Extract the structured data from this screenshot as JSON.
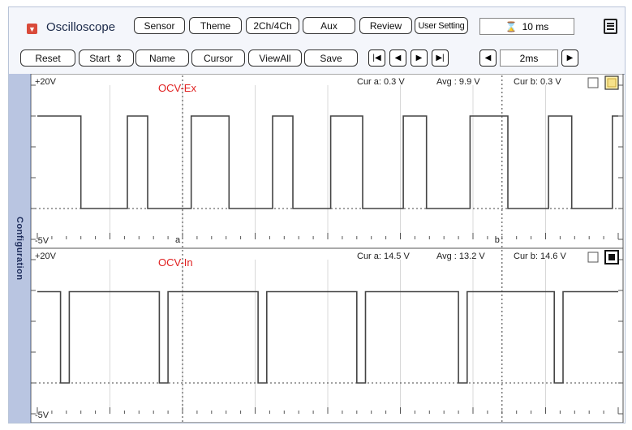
{
  "app": {
    "title": "Oscilloscope",
    "title_icon": "dropdown-arrow-icon"
  },
  "toolbar_top": {
    "sensor": "Sensor",
    "theme": "Theme",
    "channels": "2Ch/4Ch",
    "aux": "Aux",
    "review": "Review",
    "user_setting": "User Setting",
    "time": "10 ms",
    "time_icon": "hourglass-icon",
    "menu_icon": "menu-icon"
  },
  "toolbar_bottom": {
    "reset": "Reset",
    "start": "Start",
    "start_arrows": "⇕",
    "name": "Name",
    "cursor": "Cursor",
    "viewall": "ViewAll",
    "save": "Save",
    "nav_first": "|◀",
    "nav_prev": "◀",
    "nav_next": "▶",
    "nav_last": "▶|",
    "timebase_left": "◀",
    "timebase": "2ms",
    "timebase_right": "▶"
  },
  "sidebar": {
    "label": "Configuration"
  },
  "channels": [
    {
      "name": "OCV-Ex",
      "ymax_label": "+20V",
      "ymin_label": "-5V",
      "cur_a": "Cur a: 0.3 V",
      "avg": "Avg : 9.9 V",
      "cur_b": "Cur b: 0.3 V",
      "cursor_a_label": "a",
      "cursor_b_label": "b",
      "label_color": "#e02020"
    },
    {
      "name": "OCV-In",
      "ymax_label": "+20V",
      "ymin_label": "-5V",
      "cur_a": "Cur a: 14.5 V",
      "avg": "Avg : 13.2 V",
      "cur_b": "Cur b: 14.6 V",
      "label_color": "#e02020"
    }
  ],
  "chart_data": [
    {
      "type": "line",
      "series": [
        {
          "name": "OCV-Ex",
          "x": [
            0,
            1.5,
            1.5,
            3.1,
            3.1,
            3.8,
            3.8,
            5.3,
            5.3,
            6.6,
            6.6,
            8.1,
            8.1,
            8.8,
            8.8,
            10.1,
            10.1,
            11.2,
            11.2,
            12.6,
            12.6,
            13.4,
            13.4,
            14.9,
            14.9,
            16.2,
            16.2,
            17.6,
            17.6,
            18.4,
            18.4,
            19.8,
            19.8,
            20
          ],
          "y": [
            15,
            15,
            0,
            0,
            15,
            15,
            0,
            0,
            15,
            15,
            0,
            0,
            15,
            15,
            0,
            0,
            15,
            15,
            0,
            0,
            15,
            15,
            0,
            0,
            15,
            15,
            0,
            0,
            15,
            15,
            0,
            0,
            15,
            15
          ]
        }
      ],
      "ylim": [
        -5,
        20
      ],
      "xlim": [
        0,
        20
      ],
      "grid": true,
      "cursors": [
        5,
        16
      ]
    },
    {
      "type": "line",
      "series": [
        {
          "name": "OCV-In",
          "x": [
            0,
            0.8,
            0.8,
            1.1,
            1.1,
            4.2,
            4.2,
            4.5,
            4.5,
            7.6,
            7.6,
            7.9,
            7.9,
            11.0,
            11.0,
            11.3,
            11.3,
            14.5,
            14.5,
            14.8,
            14.8,
            17.8,
            17.8,
            18.1,
            18.1,
            20
          ],
          "y": [
            14.8,
            14.8,
            0,
            0,
            14.8,
            14.8,
            0,
            0,
            14.8,
            14.8,
            0,
            0,
            14.8,
            14.8,
            0,
            0,
            14.8,
            14.8,
            0,
            0,
            14.8,
            14.8,
            0,
            0,
            14.8,
            14.8
          ]
        }
      ],
      "ylim": [
        -5,
        20
      ],
      "xlim": [
        0,
        20
      ],
      "grid": true,
      "cursors": [
        5,
        16
      ]
    }
  ]
}
